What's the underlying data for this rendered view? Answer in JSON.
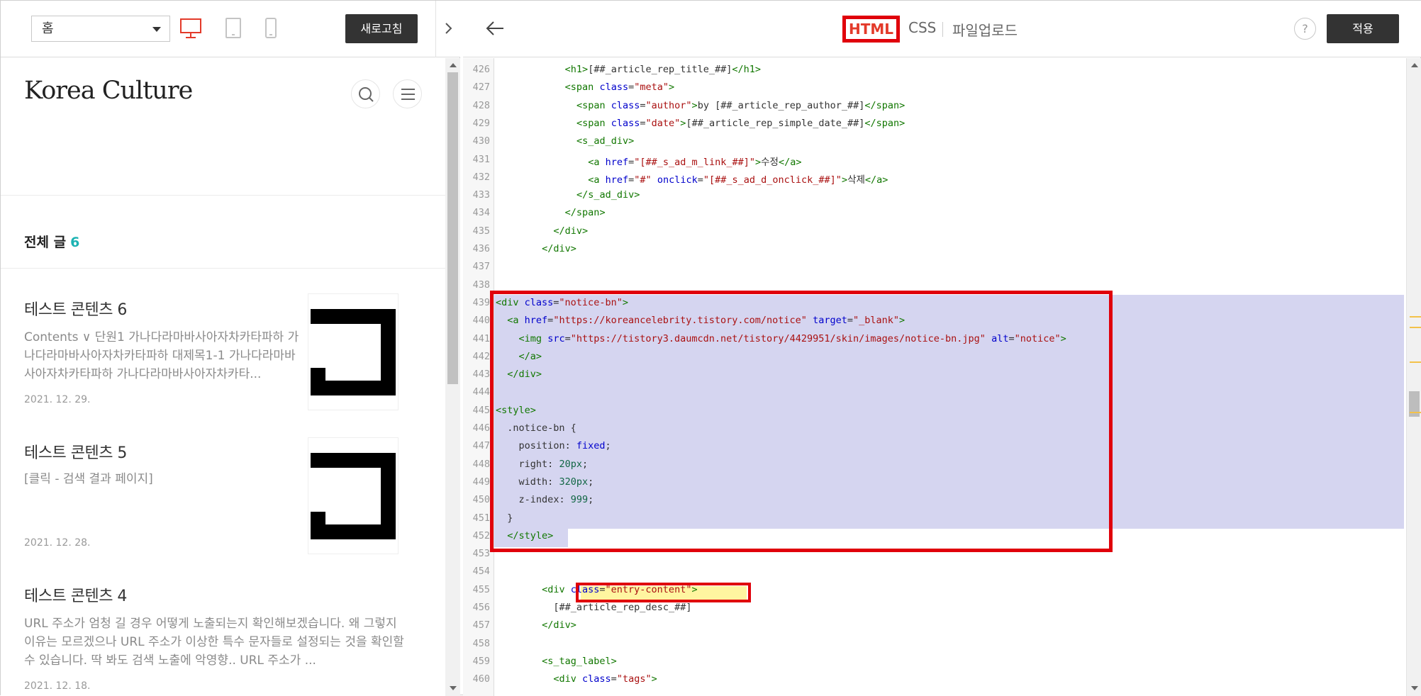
{
  "left_toolbar": {
    "page_select": "홈",
    "refresh_label": "새로고침"
  },
  "preview": {
    "blog_title": "Korea Culture",
    "all_posts_label": "전체 글",
    "all_posts_count": "6",
    "posts": [
      {
        "title": "테스트 콘텐츠 6",
        "desc": "Contents ∨ 단원1 가나다라마바사아자차카타파하 가나다라마바사아자차카타파하 대제목1-1 가나다라마바사아자차카타파하 가나다라마바사아자차카타...",
        "date": "2021. 12. 29."
      },
      {
        "title": "테스트 콘텐츠 5",
        "desc": "[클릭 - 검색 결과 페이지]",
        "date": "2021. 12. 28."
      },
      {
        "title": "테스트 콘텐츠 4",
        "desc": "URL 주소가 엄청 길 경우 어떻게 노출되는지 확인해보겠습니다. 왜 그렇지 이유는 모르겠으나 URL 주소가 이상한 특수 문자들로 설정되는 것을 확인할 수 있습니다. 딱 봐도 검색 노출에 악영향.. URL 주소가 ...",
        "date": "2021. 12. 18."
      }
    ]
  },
  "right_toolbar": {
    "tab_html": "HTML",
    "tab_css": "CSS",
    "tab_upload": "파일업로드",
    "help": "?",
    "apply_label": "적용"
  },
  "code_lines": [
    {
      "n": "426",
      "indent": 12,
      "parts": [
        [
          "tg",
          "<h1>"
        ],
        [
          "pv",
          "[##_article_rep_title_##]"
        ],
        [
          "tg",
          "</h1>"
        ]
      ]
    },
    {
      "n": "427",
      "indent": 12,
      "parts": [
        [
          "tg",
          "<span "
        ],
        [
          "an",
          "class"
        ],
        [
          "pv",
          "="
        ],
        [
          "av",
          "\"meta\""
        ],
        [
          "tg",
          ">"
        ]
      ]
    },
    {
      "n": "428",
      "indent": 14,
      "parts": [
        [
          "tg",
          "<span "
        ],
        [
          "an",
          "class"
        ],
        [
          "pv",
          "="
        ],
        [
          "av",
          "\"author\""
        ],
        [
          "tg",
          ">"
        ],
        [
          "pv",
          "by [##_article_rep_author_##]"
        ],
        [
          "tg",
          "</span>"
        ]
      ]
    },
    {
      "n": "429",
      "indent": 14,
      "parts": [
        [
          "tg",
          "<span "
        ],
        [
          "an",
          "class"
        ],
        [
          "pv",
          "="
        ],
        [
          "av",
          "\"date\""
        ],
        [
          "tg",
          ">"
        ],
        [
          "pv",
          "[##_article_rep_simple_date_##]"
        ],
        [
          "tg",
          "</span>"
        ]
      ]
    },
    {
      "n": "430",
      "indent": 14,
      "parts": [
        [
          "tg",
          "<s_ad_div>"
        ]
      ]
    },
    {
      "n": "431",
      "indent": 16,
      "parts": [
        [
          "tg",
          "<a "
        ],
        [
          "an",
          "href"
        ],
        [
          "pv",
          "="
        ],
        [
          "av",
          "\"[##_s_ad_m_link_##]\""
        ],
        [
          "tg",
          ">"
        ],
        [
          "pv",
          "수정"
        ],
        [
          "tg",
          "</a>"
        ]
      ]
    },
    {
      "n": "432",
      "indent": 16,
      "parts": [
        [
          "tg",
          "<a "
        ],
        [
          "an",
          "href"
        ],
        [
          "pv",
          "="
        ],
        [
          "av",
          "\"#\""
        ],
        [
          "pv",
          " "
        ],
        [
          "an",
          "onclick"
        ],
        [
          "pv",
          "="
        ],
        [
          "av",
          "\"[##_s_ad_d_onclick_##]\""
        ],
        [
          "tg",
          ">"
        ],
        [
          "pv",
          "삭제"
        ],
        [
          "tg",
          "</a>"
        ]
      ]
    },
    {
      "n": "433",
      "indent": 14,
      "parts": [
        [
          "tg",
          "</s_ad_div>"
        ]
      ]
    },
    {
      "n": "434",
      "indent": 12,
      "parts": [
        [
          "tg",
          "</span>"
        ]
      ]
    },
    {
      "n": "435",
      "indent": 10,
      "parts": [
        [
          "tg",
          "</div>"
        ]
      ]
    },
    {
      "n": "436",
      "indent": 8,
      "parts": [
        [
          "tg",
          "</div>"
        ]
      ]
    },
    {
      "n": "437",
      "indent": 0,
      "parts": []
    },
    {
      "n": "438",
      "indent": 0,
      "parts": []
    },
    {
      "n": "439",
      "indent": 0,
      "parts": [
        [
          "tg",
          "<div "
        ],
        [
          "an",
          "class"
        ],
        [
          "pv",
          "="
        ],
        [
          "av",
          "\"notice-bn\""
        ],
        [
          "tg",
          ">"
        ]
      ]
    },
    {
      "n": "440",
      "indent": 2,
      "parts": [
        [
          "tg",
          "<a "
        ],
        [
          "an",
          "href"
        ],
        [
          "pv",
          "="
        ],
        [
          "av",
          "\"https://koreancelebrity.tistory.com/notice\""
        ],
        [
          "pv",
          " "
        ],
        [
          "an",
          "target"
        ],
        [
          "pv",
          "="
        ],
        [
          "av",
          "\"_blank\""
        ],
        [
          "tg",
          ">"
        ]
      ]
    },
    {
      "n": "441",
      "indent": 4,
      "parts": [
        [
          "tg",
          "<img "
        ],
        [
          "an",
          "src"
        ],
        [
          "pv",
          "="
        ],
        [
          "av",
          "\"https://tistory3.daumcdn.net/tistory/4429951/skin/images/notice-bn.jpg\""
        ],
        [
          "pv",
          " "
        ],
        [
          "an",
          "alt"
        ],
        [
          "pv",
          "="
        ],
        [
          "av",
          "\"notice\""
        ],
        [
          "tg",
          ">"
        ]
      ]
    },
    {
      "n": "442",
      "indent": 4,
      "parts": [
        [
          "tg",
          "</a>"
        ]
      ]
    },
    {
      "n": "443",
      "indent": 2,
      "parts": [
        [
          "tg",
          "</div>"
        ]
      ]
    },
    {
      "n": "444",
      "indent": 0,
      "parts": []
    },
    {
      "n": "445",
      "indent": 0,
      "parts": [
        [
          "tg",
          "<style>"
        ]
      ]
    },
    {
      "n": "446",
      "indent": 2,
      "parts": [
        [
          "pv",
          ".notice-bn {"
        ]
      ]
    },
    {
      "n": "447",
      "indent": 4,
      "parts": [
        [
          "pv",
          "position: "
        ],
        [
          "an",
          "fixed"
        ],
        [
          "pv",
          ";"
        ]
      ]
    },
    {
      "n": "448",
      "indent": 4,
      "parts": [
        [
          "pv",
          "right: "
        ],
        [
          "nm",
          "20px"
        ],
        [
          "pv",
          ";"
        ]
      ]
    },
    {
      "n": "449",
      "indent": 4,
      "parts": [
        [
          "pv",
          "width: "
        ],
        [
          "nm",
          "320px"
        ],
        [
          "pv",
          ";"
        ]
      ]
    },
    {
      "n": "450",
      "indent": 4,
      "parts": [
        [
          "pv",
          "z-index: "
        ],
        [
          "nm",
          "999"
        ],
        [
          "pv",
          ";"
        ]
      ]
    },
    {
      "n": "451",
      "indent": 2,
      "parts": [
        [
          "pv",
          "}"
        ]
      ]
    },
    {
      "n": "452",
      "indent": 2,
      "parts": [
        [
          "tg",
          "</style>"
        ]
      ]
    },
    {
      "n": "453",
      "indent": 0,
      "parts": []
    },
    {
      "n": "454",
      "indent": 0,
      "parts": []
    },
    {
      "n": "455",
      "indent": 8,
      "parts": [
        [
          "tg",
          "<div "
        ],
        [
          "an",
          "class"
        ],
        [
          "pv",
          "="
        ],
        [
          "av",
          "\"entry-content\""
        ],
        [
          "tg",
          ">"
        ]
      ]
    },
    {
      "n": "456",
      "indent": 10,
      "parts": [
        [
          "pv",
          "[##_article_rep_desc_##]"
        ]
      ]
    },
    {
      "n": "457",
      "indent": 8,
      "parts": [
        [
          "tg",
          "</div>"
        ]
      ]
    },
    {
      "n": "458",
      "indent": 0,
      "parts": []
    },
    {
      "n": "459",
      "indent": 8,
      "parts": [
        [
          "tg",
          "<s_tag_label>"
        ]
      ]
    },
    {
      "n": "460",
      "indent": 10,
      "parts": [
        [
          "tg",
          "<div "
        ],
        [
          "an",
          "class"
        ],
        [
          "pv",
          "="
        ],
        [
          "av",
          "\"tags\""
        ],
        [
          "tg",
          ">"
        ]
      ]
    }
  ],
  "colors": {
    "accent_red": "#e0000b",
    "selection": "#d5d5f0",
    "count_teal": "#1cb3b3",
    "button_dark": "#333333"
  }
}
